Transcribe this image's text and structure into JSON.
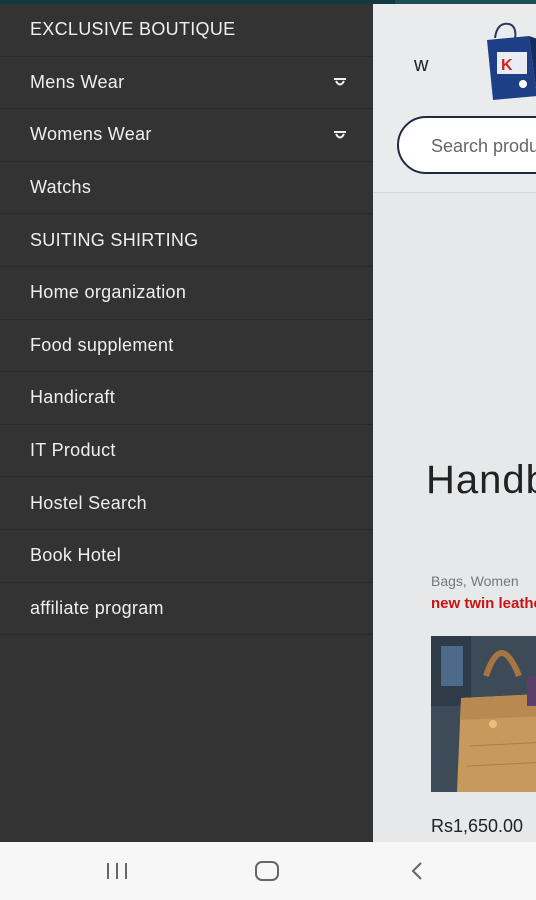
{
  "drawer": {
    "items": [
      {
        "label": "EXCLUSIVE BOUTIQUE",
        "expandable": false
      },
      {
        "label": "Mens Wear",
        "expandable": true
      },
      {
        "label": "Womens Wear",
        "expandable": true
      },
      {
        "label": "Watchs",
        "expandable": false
      },
      {
        "label": "SUITING SHIRTING",
        "expandable": false
      },
      {
        "label": "Home organization",
        "expandable": false
      },
      {
        "label": "Food supplement",
        "expandable": false
      },
      {
        "label": "Handicraft",
        "expandable": false
      },
      {
        "label": "IT Product",
        "expandable": false
      },
      {
        "label": "Hostel Search",
        "expandable": false
      },
      {
        "label": "Book Hotel",
        "expandable": false
      },
      {
        "label": "affiliate program",
        "expandable": false
      }
    ]
  },
  "page": {
    "brand_letter": "w",
    "search": {
      "placeholder": "Search products…"
    },
    "section_title": "Handbags",
    "product": {
      "categories": "Bags, Women",
      "name": "new twin leather bag",
      "price": "Rs1,650.00"
    }
  },
  "colors": {
    "drawer_bg": "#333333",
    "page_bg": "#e6e8ea",
    "accent_red": "#cc1111",
    "search_border": "#1f2b44"
  },
  "icons": {
    "expand": "chevron-down-icon",
    "recents": "recents-icon",
    "home": "home-icon",
    "back": "back-icon"
  }
}
